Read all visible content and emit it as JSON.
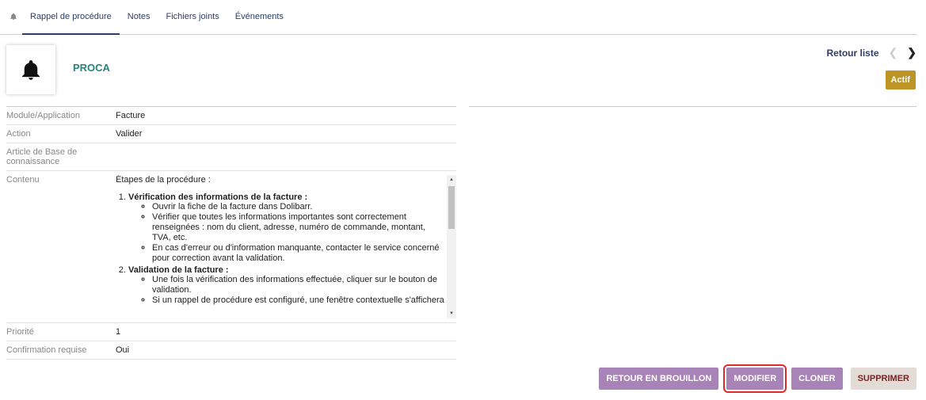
{
  "tabs": [
    {
      "label": "Rappel de procédure",
      "active": true
    },
    {
      "label": "Notes",
      "active": false
    },
    {
      "label": "Fichiers joints",
      "active": false
    },
    {
      "label": "Événements",
      "active": false
    }
  ],
  "header": {
    "ref": "PROCA",
    "back_to_list": "Retour liste",
    "status": "Actif"
  },
  "fields": {
    "module_label": "Module/Application",
    "module_value": "Facture",
    "action_label": "Action",
    "action_value": "Valider",
    "kb_label": "Article de Base de connaissance",
    "kb_value": "",
    "contenu_label": "Contenu",
    "priority_label": "Priorité",
    "priority_value": "1",
    "confirmation_label": "Confirmation requise",
    "confirmation_value": "Oui"
  },
  "contenu": {
    "intro": "Étapes de la procédure :",
    "step1_title": "Vérification des informations de la facture :",
    "step1_items": [
      "Ouvrir la fiche de la facture dans Dolibarr.",
      "Vérifier que toutes les informations importantes sont correctement renseignées : nom du client, adresse, numéro de commande, montant, TVA, etc.",
      "En cas d'erreur ou d'information manquante, contacter le service concerné pour correction avant la validation."
    ],
    "step2_title": "Validation de la facture :",
    "step2_items": [
      "Une fois la vérification des informations effectuée, cliquer sur le bouton de validation.",
      "Si un rappel de procédure est configuré, une fenêtre contextuelle s'affichera"
    ]
  },
  "buttons": {
    "retour_brouillon": "RETOUR EN BROUILLON",
    "modifier": "MODIFIER",
    "cloner": "CLONER",
    "supprimer": "SUPPRIMER"
  },
  "colors": {
    "accent": "#2c3e66",
    "title": "#25847c",
    "status": "#bc9526",
    "button": "#a883b7",
    "highlight": "#e02b2b"
  }
}
